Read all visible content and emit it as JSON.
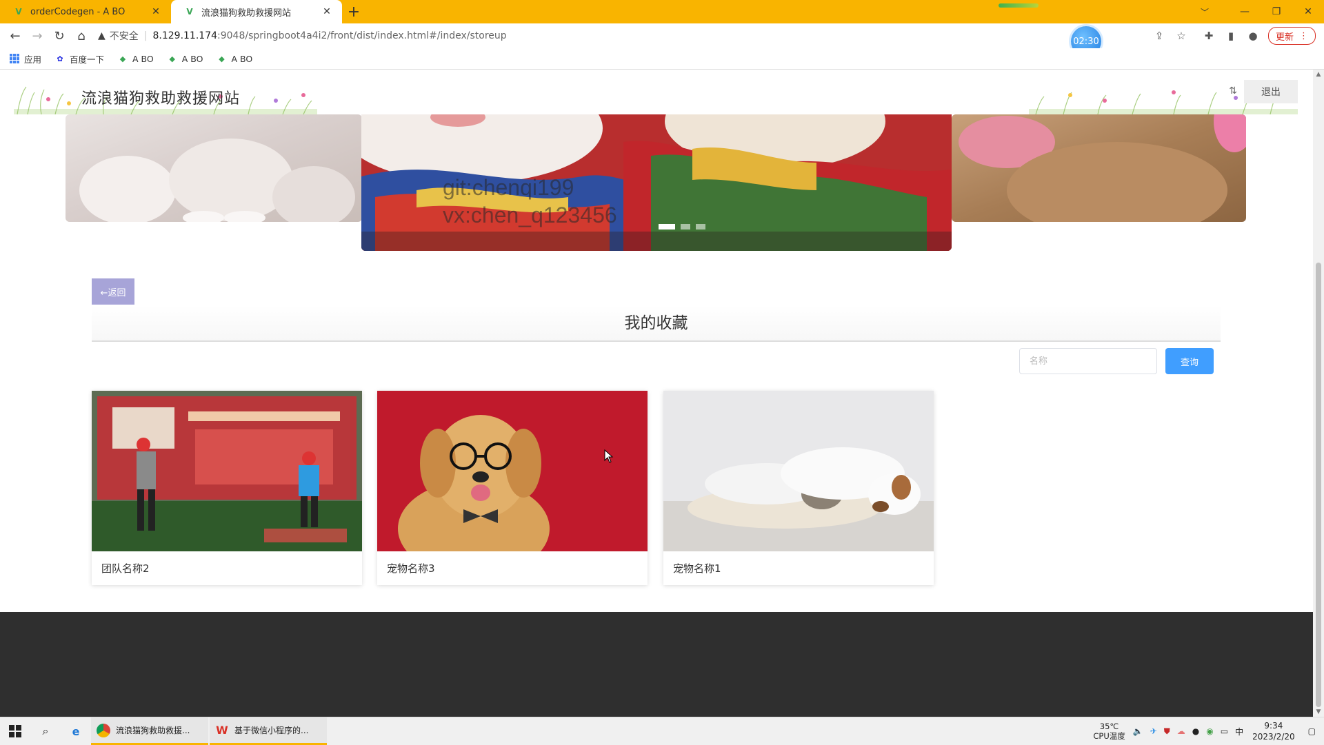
{
  "browser": {
    "tabs": [
      {
        "title": "orderCodegen - A BO",
        "favicon": "vue-logo-icon",
        "active": false
      },
      {
        "title": "流浪猫狗救助救援网站",
        "favicon": "vue-logo-icon",
        "active": true
      }
    ],
    "address": {
      "security_label": "不安全",
      "host": "8.129.11.174",
      "path": ":9048/springboot4a4i2/front/dist/index.html#/index/storeup"
    },
    "timer": "02:30",
    "update_label": "更新",
    "bookmarks": [
      {
        "label": "应用",
        "icon": "apps-grid-icon"
      },
      {
        "label": "百度一下",
        "icon": "baidu-paw-icon"
      },
      {
        "label": "A BO",
        "icon": "vue-logo-icon"
      },
      {
        "label": "A BO",
        "icon": "vue-logo-icon"
      },
      {
        "label": "A BO",
        "icon": "vue-logo-icon"
      }
    ]
  },
  "site": {
    "title": "流浪猫狗救助救援网站",
    "logout_label": "退出"
  },
  "carousel": {
    "watermark_line1": "git:chenqi199",
    "watermark_line2": "vx:chen_q123456",
    "slide_count": 3,
    "active_slide": 0
  },
  "page": {
    "back_label": "←返回",
    "section_title": "我的收藏",
    "search": {
      "placeholder": "名称",
      "value": "",
      "button_label": "查询"
    },
    "cards": [
      {
        "name": "团队名称2",
        "image": "volunteers-cleaning-board-photo"
      },
      {
        "name": "宠物名称3",
        "image": "golden-retriever-glasses-photo"
      },
      {
        "name": "宠物名称1",
        "image": "cat-and-dog-sleeping-photo"
      }
    ]
  },
  "taskbar": {
    "tasks": [
      {
        "label": "流浪猫狗救助救援...",
        "icon": "chrome-icon"
      },
      {
        "label": "基于微信小程序的...",
        "icon": "wps-icon"
      }
    ],
    "temperature": "35℃",
    "temperature_label": "CPU温度",
    "ime": "中",
    "time": "9:34",
    "date": "2023/2/20"
  },
  "colors": {
    "tabbar": "#f9b400",
    "back_button": "#a7a4d8",
    "search_button": "#409eff",
    "footer": "#2f2f2f"
  }
}
